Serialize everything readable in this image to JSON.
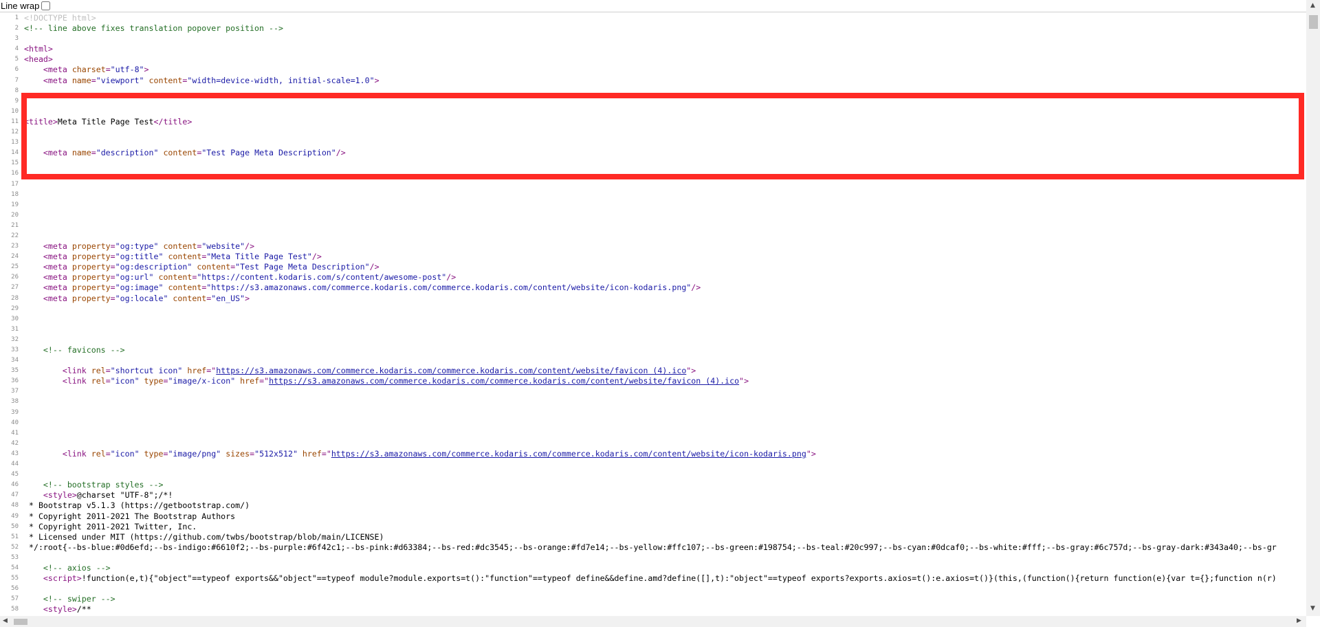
{
  "toolbar": {
    "line_wrap_label": "Line wrap"
  },
  "lines": [
    {
      "n": "1",
      "code": [
        {
          "k": "d",
          "t": "<!DOCTYPE html>"
        }
      ]
    },
    {
      "n": "2",
      "code": [
        {
          "k": "c",
          "t": "<!-- line above fixes translation popover position -->"
        }
      ]
    },
    {
      "n": "3",
      "code": []
    },
    {
      "n": "4",
      "code": [
        {
          "k": "t",
          "t": "<html>"
        }
      ]
    },
    {
      "n": "5",
      "code": [
        {
          "k": "t",
          "t": "<head>"
        }
      ]
    },
    {
      "n": "6",
      "code": [
        {
          "k": "p",
          "t": "    "
        },
        {
          "k": "t",
          "t": "<meta "
        },
        {
          "k": "a",
          "t": "charset"
        },
        {
          "k": "t",
          "t": "="
        },
        {
          "k": "v",
          "t": "\"utf-8\""
        },
        {
          "k": "t",
          "t": ">"
        }
      ]
    },
    {
      "n": "7",
      "code": [
        {
          "k": "p",
          "t": "    "
        },
        {
          "k": "t",
          "t": "<meta "
        },
        {
          "k": "a",
          "t": "name"
        },
        {
          "k": "t",
          "t": "="
        },
        {
          "k": "v",
          "t": "\"viewport\""
        },
        {
          "k": "p",
          "t": " "
        },
        {
          "k": "a",
          "t": "content"
        },
        {
          "k": "t",
          "t": "="
        },
        {
          "k": "v",
          "t": "\"width=device-width, initial-scale=1.0\""
        },
        {
          "k": "t",
          "t": ">"
        }
      ]
    },
    {
      "n": "8",
      "code": []
    },
    {
      "n": "9",
      "code": []
    },
    {
      "n": "10",
      "code": []
    },
    {
      "n": "11",
      "code": [
        {
          "k": "t",
          "t": "<title>"
        },
        {
          "k": "p",
          "t": "Meta Title Page Test"
        },
        {
          "k": "t",
          "t": "</title>"
        }
      ]
    },
    {
      "n": "12",
      "code": []
    },
    {
      "n": "13",
      "code": []
    },
    {
      "n": "14",
      "code": [
        {
          "k": "p",
          "t": "    "
        },
        {
          "k": "t",
          "t": "<meta "
        },
        {
          "k": "a",
          "t": "name"
        },
        {
          "k": "t",
          "t": "="
        },
        {
          "k": "v",
          "t": "\"description\""
        },
        {
          "k": "p",
          "t": " "
        },
        {
          "k": "a",
          "t": "content"
        },
        {
          "k": "t",
          "t": "="
        },
        {
          "k": "v",
          "t": "\"Test Page Meta Description\""
        },
        {
          "k": "t",
          "t": "/>"
        }
      ]
    },
    {
      "n": "15",
      "code": []
    },
    {
      "n": "16",
      "code": []
    },
    {
      "n": "17",
      "code": []
    },
    {
      "n": "18",
      "code": []
    },
    {
      "n": "19",
      "code": []
    },
    {
      "n": "20",
      "code": []
    },
    {
      "n": "21",
      "code": []
    },
    {
      "n": "22",
      "code": []
    },
    {
      "n": "23",
      "code": [
        {
          "k": "p",
          "t": "    "
        },
        {
          "k": "t",
          "t": "<meta "
        },
        {
          "k": "a",
          "t": "property"
        },
        {
          "k": "t",
          "t": "="
        },
        {
          "k": "v",
          "t": "\"og:type\""
        },
        {
          "k": "p",
          "t": " "
        },
        {
          "k": "a",
          "t": "content"
        },
        {
          "k": "t",
          "t": "="
        },
        {
          "k": "v",
          "t": "\"website\""
        },
        {
          "k": "t",
          "t": "/>"
        }
      ]
    },
    {
      "n": "24",
      "code": [
        {
          "k": "p",
          "t": "    "
        },
        {
          "k": "t",
          "t": "<meta "
        },
        {
          "k": "a",
          "t": "property"
        },
        {
          "k": "t",
          "t": "="
        },
        {
          "k": "v",
          "t": "\"og:title\""
        },
        {
          "k": "p",
          "t": " "
        },
        {
          "k": "a",
          "t": "content"
        },
        {
          "k": "t",
          "t": "="
        },
        {
          "k": "v",
          "t": "\"Meta Title Page Test\""
        },
        {
          "k": "t",
          "t": "/>"
        }
      ]
    },
    {
      "n": "25",
      "code": [
        {
          "k": "p",
          "t": "    "
        },
        {
          "k": "t",
          "t": "<meta "
        },
        {
          "k": "a",
          "t": "property"
        },
        {
          "k": "t",
          "t": "="
        },
        {
          "k": "v",
          "t": "\"og:description\""
        },
        {
          "k": "p",
          "t": " "
        },
        {
          "k": "a",
          "t": "content"
        },
        {
          "k": "t",
          "t": "="
        },
        {
          "k": "v",
          "t": "\"Test Page Meta Description\""
        },
        {
          "k": "t",
          "t": "/>"
        }
      ]
    },
    {
      "n": "26",
      "code": [
        {
          "k": "p",
          "t": "    "
        },
        {
          "k": "t",
          "t": "<meta "
        },
        {
          "k": "a",
          "t": "property"
        },
        {
          "k": "t",
          "t": "="
        },
        {
          "k": "v",
          "t": "\"og:url\""
        },
        {
          "k": "p",
          "t": " "
        },
        {
          "k": "a",
          "t": "content"
        },
        {
          "k": "t",
          "t": "="
        },
        {
          "k": "v",
          "t": "\"https://content.kodaris.com/s/content/awesome-post\""
        },
        {
          "k": "t",
          "t": "/>"
        }
      ]
    },
    {
      "n": "27",
      "code": [
        {
          "k": "p",
          "t": "    "
        },
        {
          "k": "t",
          "t": "<meta "
        },
        {
          "k": "a",
          "t": "property"
        },
        {
          "k": "t",
          "t": "="
        },
        {
          "k": "v",
          "t": "\"og:image\""
        },
        {
          "k": "p",
          "t": " "
        },
        {
          "k": "a",
          "t": "content"
        },
        {
          "k": "t",
          "t": "="
        },
        {
          "k": "v",
          "t": "\"https://s3.amazonaws.com/commerce.kodaris.com/commerce.kodaris.com/content/website/icon-kodaris.png\""
        },
        {
          "k": "t",
          "t": "/>"
        }
      ]
    },
    {
      "n": "28",
      "code": [
        {
          "k": "p",
          "t": "    "
        },
        {
          "k": "t",
          "t": "<meta "
        },
        {
          "k": "a",
          "t": "property"
        },
        {
          "k": "t",
          "t": "="
        },
        {
          "k": "v",
          "t": "\"og:locale\""
        },
        {
          "k": "p",
          "t": " "
        },
        {
          "k": "a",
          "t": "content"
        },
        {
          "k": "t",
          "t": "="
        },
        {
          "k": "v",
          "t": "\"en_US\""
        },
        {
          "k": "t",
          "t": ">"
        }
      ]
    },
    {
      "n": "29",
      "code": []
    },
    {
      "n": "30",
      "code": []
    },
    {
      "n": "31",
      "code": []
    },
    {
      "n": "32",
      "code": []
    },
    {
      "n": "33",
      "code": [
        {
          "k": "p",
          "t": "    "
        },
        {
          "k": "c",
          "t": "<!-- favicons -->"
        }
      ]
    },
    {
      "n": "34",
      "code": []
    },
    {
      "n": "35",
      "code": [
        {
          "k": "p",
          "t": "        "
        },
        {
          "k": "t",
          "t": "<link "
        },
        {
          "k": "a",
          "t": "rel"
        },
        {
          "k": "t",
          "t": "="
        },
        {
          "k": "v",
          "t": "\"shortcut icon\""
        },
        {
          "k": "p",
          "t": " "
        },
        {
          "k": "a",
          "t": "href"
        },
        {
          "k": "t",
          "t": "=\""
        },
        {
          "k": "l",
          "t": "https://s3.amazonaws.com/commerce.kodaris.com/commerce.kodaris.com/content/website/favicon (4).ico"
        },
        {
          "k": "t",
          "t": "\">"
        }
      ]
    },
    {
      "n": "36",
      "code": [
        {
          "k": "p",
          "t": "        "
        },
        {
          "k": "t",
          "t": "<link "
        },
        {
          "k": "a",
          "t": "rel"
        },
        {
          "k": "t",
          "t": "="
        },
        {
          "k": "v",
          "t": "\"icon\""
        },
        {
          "k": "p",
          "t": " "
        },
        {
          "k": "a",
          "t": "type"
        },
        {
          "k": "t",
          "t": "="
        },
        {
          "k": "v",
          "t": "\"image/x-icon\""
        },
        {
          "k": "p",
          "t": " "
        },
        {
          "k": "a",
          "t": "href"
        },
        {
          "k": "t",
          "t": "=\""
        },
        {
          "k": "l",
          "t": "https://s3.amazonaws.com/commerce.kodaris.com/commerce.kodaris.com/content/website/favicon (4).ico"
        },
        {
          "k": "t",
          "t": "\">"
        }
      ]
    },
    {
      "n": "37",
      "code": []
    },
    {
      "n": "38",
      "code": []
    },
    {
      "n": "39",
      "code": []
    },
    {
      "n": "40",
      "code": []
    },
    {
      "n": "41",
      "code": []
    },
    {
      "n": "42",
      "code": []
    },
    {
      "n": "43",
      "code": [
        {
          "k": "p",
          "t": "        "
        },
        {
          "k": "t",
          "t": "<link "
        },
        {
          "k": "a",
          "t": "rel"
        },
        {
          "k": "t",
          "t": "="
        },
        {
          "k": "v",
          "t": "\"icon\""
        },
        {
          "k": "p",
          "t": " "
        },
        {
          "k": "a",
          "t": "type"
        },
        {
          "k": "t",
          "t": "="
        },
        {
          "k": "v",
          "t": "\"image/png\""
        },
        {
          "k": "p",
          "t": " "
        },
        {
          "k": "a",
          "t": "sizes"
        },
        {
          "k": "t",
          "t": "="
        },
        {
          "k": "v",
          "t": "\"512x512\""
        },
        {
          "k": "p",
          "t": " "
        },
        {
          "k": "a",
          "t": "href"
        },
        {
          "k": "t",
          "t": "=\""
        },
        {
          "k": "l",
          "t": "https://s3.amazonaws.com/commerce.kodaris.com/commerce.kodaris.com/content/website/icon-kodaris.png"
        },
        {
          "k": "t",
          "t": "\">"
        }
      ]
    },
    {
      "n": "44",
      "code": []
    },
    {
      "n": "45",
      "code": []
    },
    {
      "n": "46",
      "code": [
        {
          "k": "p",
          "t": "    "
        },
        {
          "k": "c",
          "t": "<!-- bootstrap styles -->"
        }
      ]
    },
    {
      "n": "47",
      "code": [
        {
          "k": "p",
          "t": "    "
        },
        {
          "k": "t",
          "t": "<style>"
        },
        {
          "k": "p",
          "t": "@charset \"UTF-8\";/*!"
        }
      ]
    },
    {
      "n": "48",
      "code": [
        {
          "k": "p",
          "t": " * Bootstrap v5.1.3 (https://getbootstrap.com/)"
        }
      ]
    },
    {
      "n": "49",
      "code": [
        {
          "k": "p",
          "t": " * Copyright 2011-2021 The Bootstrap Authors"
        }
      ]
    },
    {
      "n": "50",
      "code": [
        {
          "k": "p",
          "t": " * Copyright 2011-2021 Twitter, Inc."
        }
      ]
    },
    {
      "n": "51",
      "code": [
        {
          "k": "p",
          "t": " * Licensed under MIT (https://github.com/twbs/bootstrap/blob/main/LICENSE)"
        }
      ]
    },
    {
      "n": "52",
      "code": [
        {
          "k": "p",
          "t": " */:root{--bs-blue:#0d6efd;--bs-indigo:#6610f2;--bs-purple:#6f42c1;--bs-pink:#d63384;--bs-red:#dc3545;--bs-orange:#fd7e14;--bs-yellow:#ffc107;--bs-green:#198754;--bs-teal:#20c997;--bs-cyan:#0dcaf0;--bs-white:#fff;--bs-gray:#6c757d;--bs-gray-dark:#343a40;--bs-gr"
        }
      ]
    },
    {
      "n": "53",
      "code": []
    },
    {
      "n": "54",
      "code": [
        {
          "k": "p",
          "t": "    "
        },
        {
          "k": "c",
          "t": "<!-- axios -->"
        }
      ]
    },
    {
      "n": "55",
      "code": [
        {
          "k": "p",
          "t": "    "
        },
        {
          "k": "t",
          "t": "<script>"
        },
        {
          "k": "p",
          "t": "!function(e,t){\"object\"==typeof exports&&\"object\"==typeof module?module.exports=t():\"function\"==typeof define&&define.amd?define([],t):\"object\"==typeof exports?exports.axios=t():e.axios=t()}(this,(function(){return function(e){var t={};function n(r)"
        }
      ]
    },
    {
      "n": "56",
      "code": []
    },
    {
      "n": "57",
      "code": [
        {
          "k": "p",
          "t": "    "
        },
        {
          "k": "c",
          "t": "<!-- swiper -->"
        }
      ]
    },
    {
      "n": "58",
      "code": [
        {
          "k": "p",
          "t": "    "
        },
        {
          "k": "t",
          "t": "<style>"
        },
        {
          "k": "p",
          "t": "/**"
        }
      ]
    }
  ],
  "colors": {
    "tag": "#881280",
    "attribute": "#994500",
    "value": "#1a1aa6",
    "comment": "#236e25",
    "highlight": "#ff2a25"
  },
  "icons": {
    "scroll_up": "triangle-up",
    "scroll_down": "triangle-down",
    "scroll_left": "triangle-left",
    "scroll_right": "triangle-right"
  }
}
